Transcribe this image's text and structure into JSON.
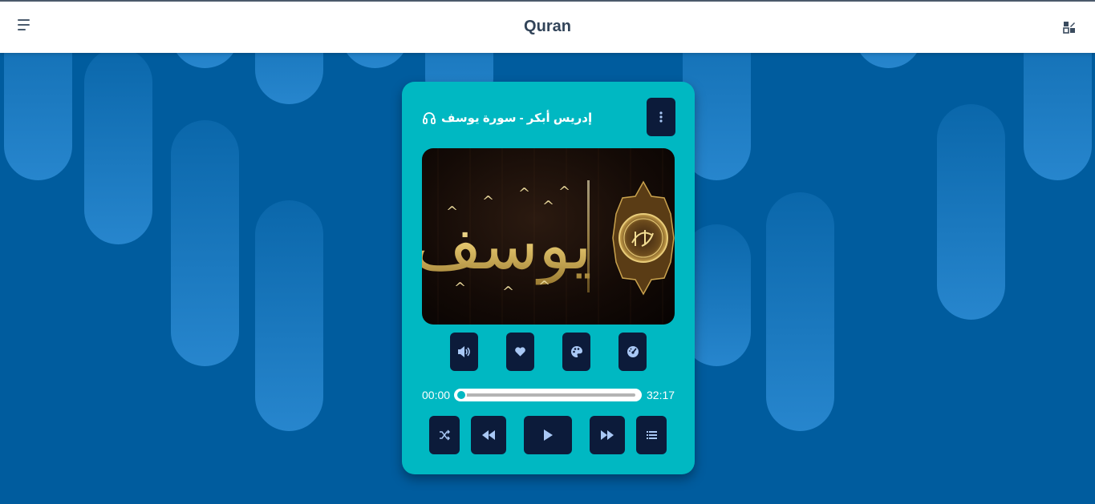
{
  "header": {
    "title": "Quran",
    "menu_icon": "menu-icon",
    "theme_icon": "theme-toggle-icon"
  },
  "player": {
    "track_title": "إدريس أبكر - سورة يوسف",
    "headphones_icon": "headphones-icon",
    "more_icon": "more-vertical-icon",
    "cover_label": "يوسف",
    "current_time": "00:00",
    "duration": "32:17",
    "progress": 0,
    "tools": [
      "volume-icon",
      "favorite-icon",
      "palette-icon",
      "speed-icon"
    ],
    "controls": [
      "shuffle-icon",
      "rewind-icon",
      "play-icon",
      "fast-forward-icon",
      "playlist-icon"
    ]
  },
  "colors": {
    "page_background": "#005c9e",
    "card": "#00b8c2",
    "button": "#0c1b3a",
    "icon": "#a9c8f5"
  }
}
